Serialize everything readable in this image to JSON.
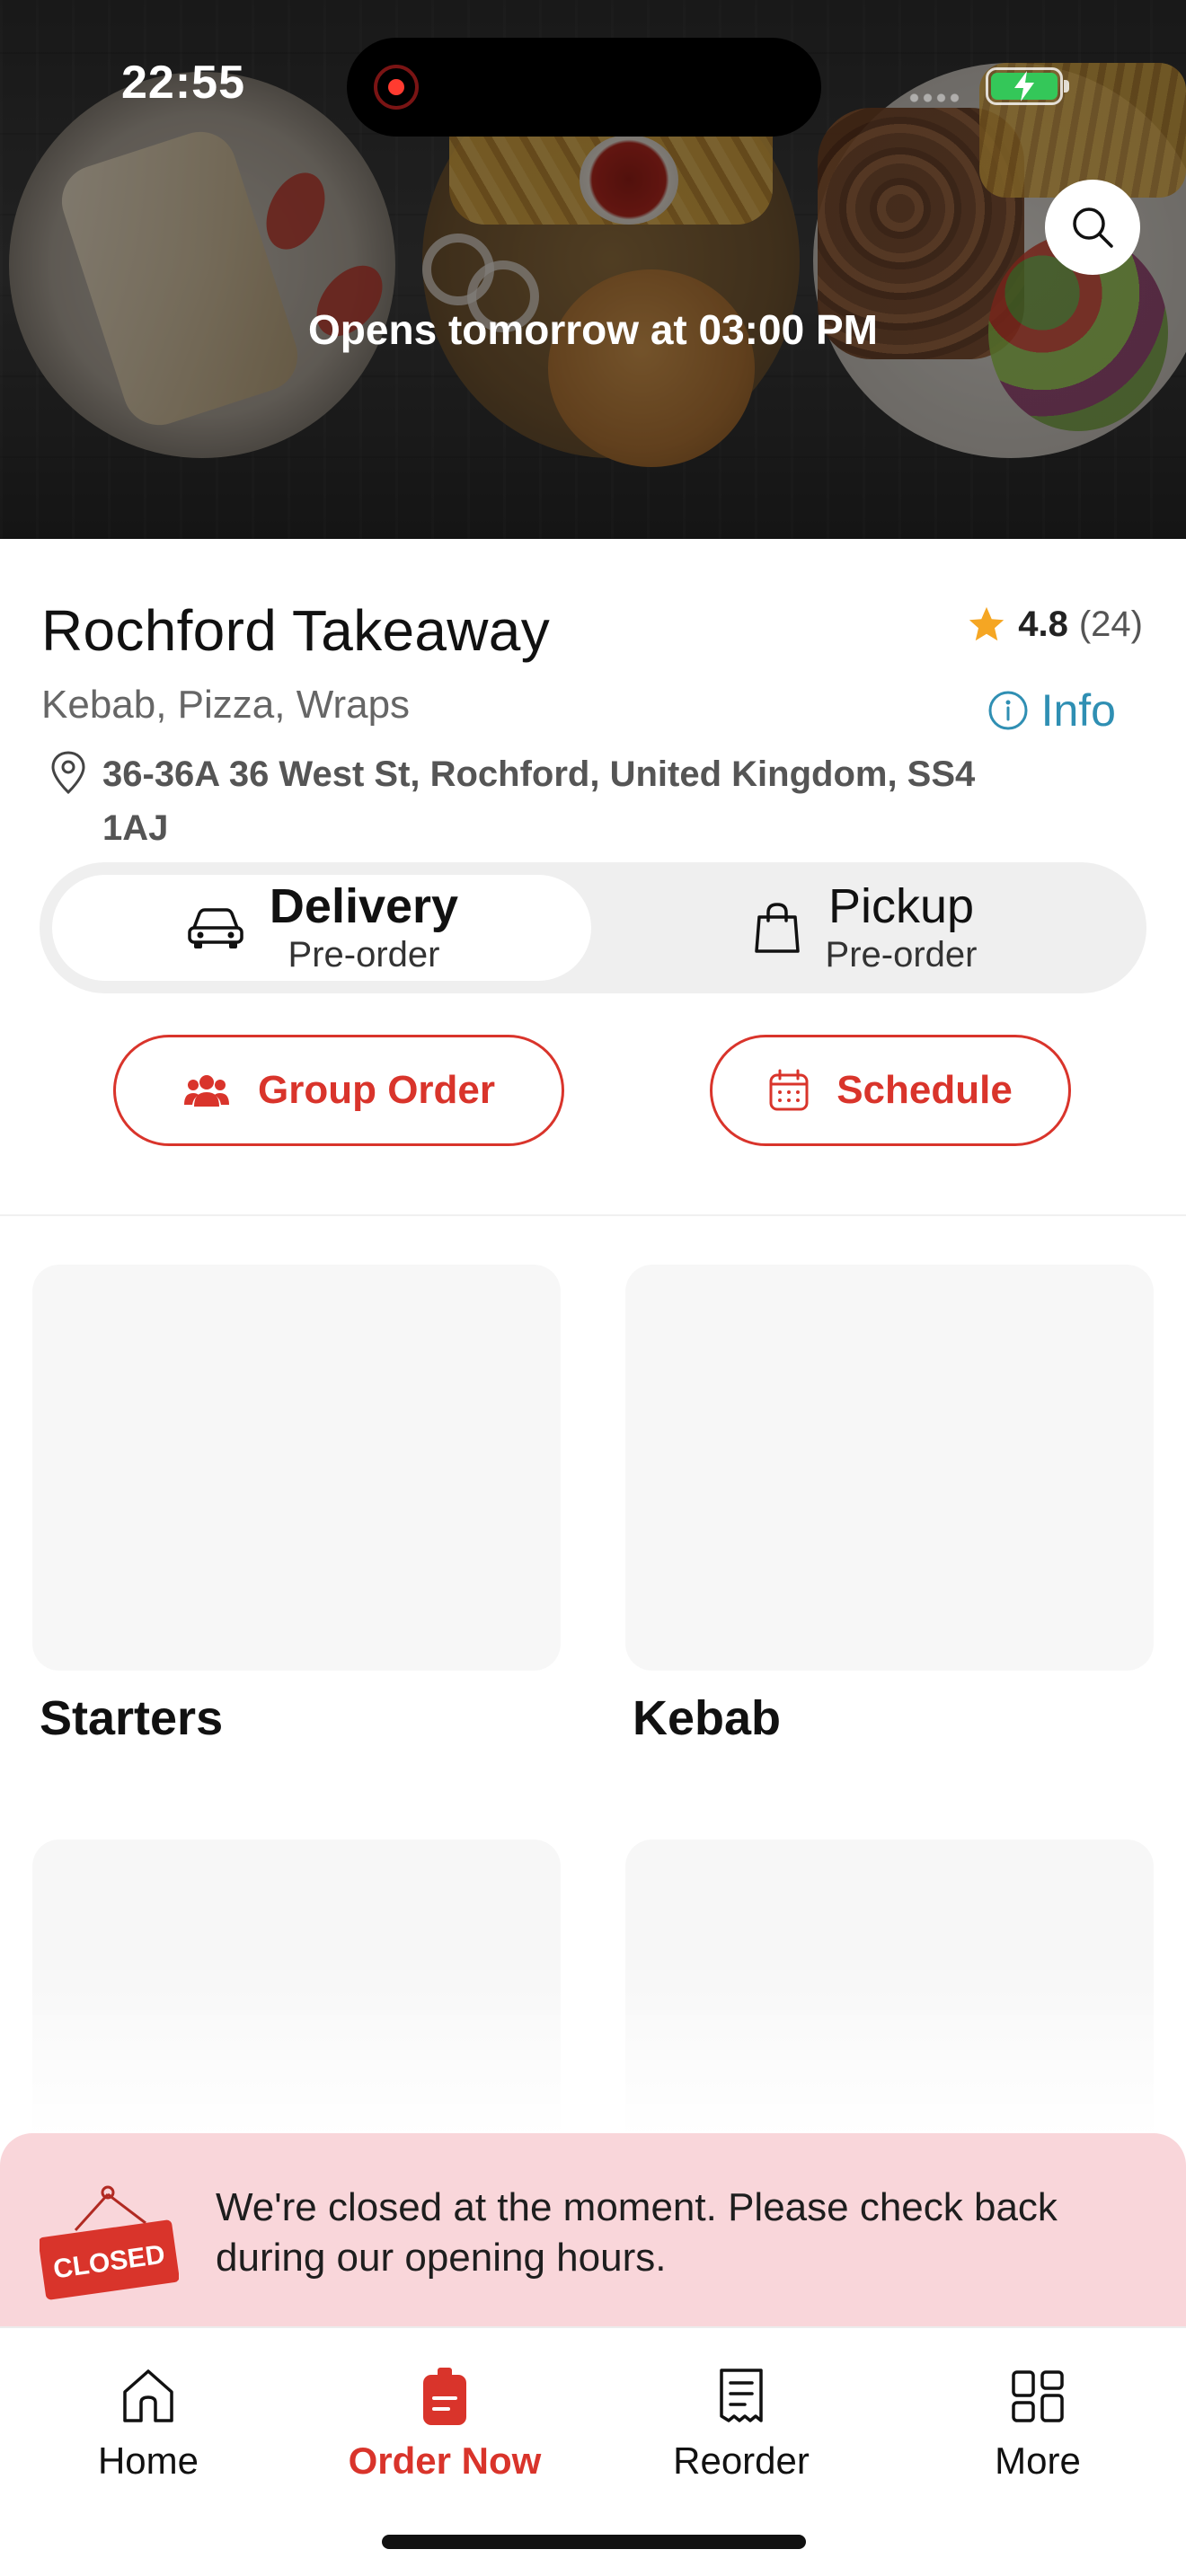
{
  "status_bar": {
    "time": "22:55"
  },
  "hero": {
    "opens_text": "Opens tomorrow at 03:00 PM"
  },
  "restaurant": {
    "name": "Rochford Takeaway",
    "rating": "4.8",
    "rating_count": "(24)",
    "cuisines": "Kebab, Pizza, Wraps",
    "info_label": "Info",
    "address": "36-36A 36 West St, Rochford, United Kingdom, SS4 1AJ"
  },
  "order_modes": [
    {
      "title": "Delivery",
      "subtitle": "Pre-order",
      "selected": true,
      "icon": "car-icon"
    },
    {
      "title": "Pickup",
      "subtitle": "Pre-order",
      "selected": false,
      "icon": "shopping-bag-icon"
    }
  ],
  "actions": {
    "group_order": "Group Order",
    "schedule": "Schedule"
  },
  "categories": [
    {
      "label": "Starters"
    },
    {
      "label": "Kebab"
    },
    {
      "label": ""
    },
    {
      "label": ""
    }
  ],
  "closed_banner": {
    "sign_text": "CLOSED",
    "message": "We're closed at the moment. Please check back during our opening hours."
  },
  "tabs": [
    {
      "label": "Home",
      "icon": "home-icon",
      "active": false
    },
    {
      "label": "Order Now",
      "icon": "order-icon",
      "active": true
    },
    {
      "label": "Reorder",
      "icon": "receipt-icon",
      "active": false
    },
    {
      "label": "More",
      "icon": "grid-icon",
      "active": false
    }
  ],
  "colors": {
    "accent": "#d9342b",
    "info_link": "#2f8fb3",
    "star": "#f5a623",
    "closed_banner_bg": "#f9d6da",
    "toggle_bg": "#efefef",
    "battery": "#34c759"
  }
}
